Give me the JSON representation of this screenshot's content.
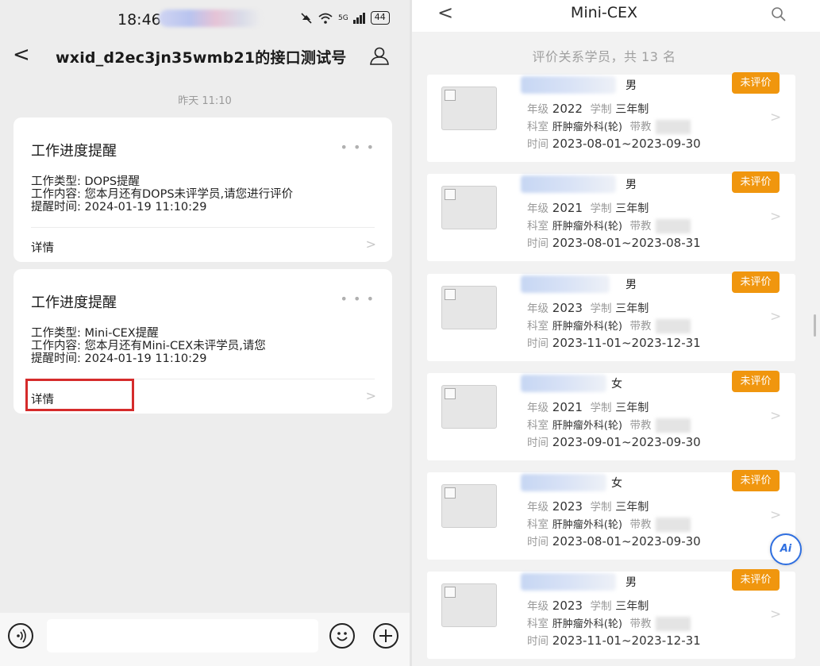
{
  "left": {
    "status": {
      "time": "18:46",
      "network": "5G",
      "battery": "44"
    },
    "chat_title": "wxid_d2ec3jn35wmb21的接口测试号",
    "date": "昨天 11:10",
    "cards": [
      {
        "title": "工作进度提醒",
        "lines": [
          "工作类型:  DOPS提醒",
          "工作内容:  您本月还有DOPS未评学员,请您进行评价",
          "提醒时间:  2024-01-19 11:10:29"
        ],
        "link": "详情"
      },
      {
        "title": "工作进度提醒",
        "lines": [
          "工作类型:  Mini-CEX提醒",
          "工作内容:  您本月还有Mini-CEX未评学员,请您",
          "提醒时间:  2024-01-19 11:10:29"
        ],
        "link": "详情"
      }
    ]
  },
  "right": {
    "title": "Mini-CEX",
    "count_text": "评价关系学员，共 13 名",
    "labels": {
      "grade": "年级",
      "system": "学制",
      "dept": "科室",
      "tutor": "带教",
      "time": "时间"
    },
    "students": [
      {
        "gender": "男",
        "grade": "2022",
        "system": "三年制",
        "dept": "肝肿瘤外科(轮)",
        "time": "2023-08-01~2023-09-30",
        "status": "未评价"
      },
      {
        "gender": "男",
        "grade": "2021",
        "system": "三年制",
        "dept": "肝肿瘤外科(轮)",
        "time": "2023-08-01~2023-08-31",
        "status": "未评价"
      },
      {
        "gender": "男",
        "grade": "2023",
        "system": "三年制",
        "dept": "肝肿瘤外科(轮)",
        "time": "2023-11-01~2023-12-31",
        "status": "未评价"
      },
      {
        "gender": "女",
        "grade": "2021",
        "system": "三年制",
        "dept": "肝肿瘤外科(轮)",
        "time": "2023-09-01~2023-09-30",
        "status": "未评价"
      },
      {
        "gender": "女",
        "grade": "2023",
        "system": "三年制",
        "dept": "肝肿瘤外科(轮)",
        "time": "2023-08-01~2023-09-30",
        "status": "未评价"
      },
      {
        "gender": "男",
        "grade": "2023",
        "system": "三年制",
        "dept": "肝肿瘤外科(轮)",
        "time": "2023-11-01~2023-12-31",
        "status": "未评价"
      }
    ],
    "ai_label": "Ai"
  },
  "colors": {
    "badge": "#f0960e",
    "highlight": "#d52b2b",
    "ai": "#2f6fe0"
  }
}
